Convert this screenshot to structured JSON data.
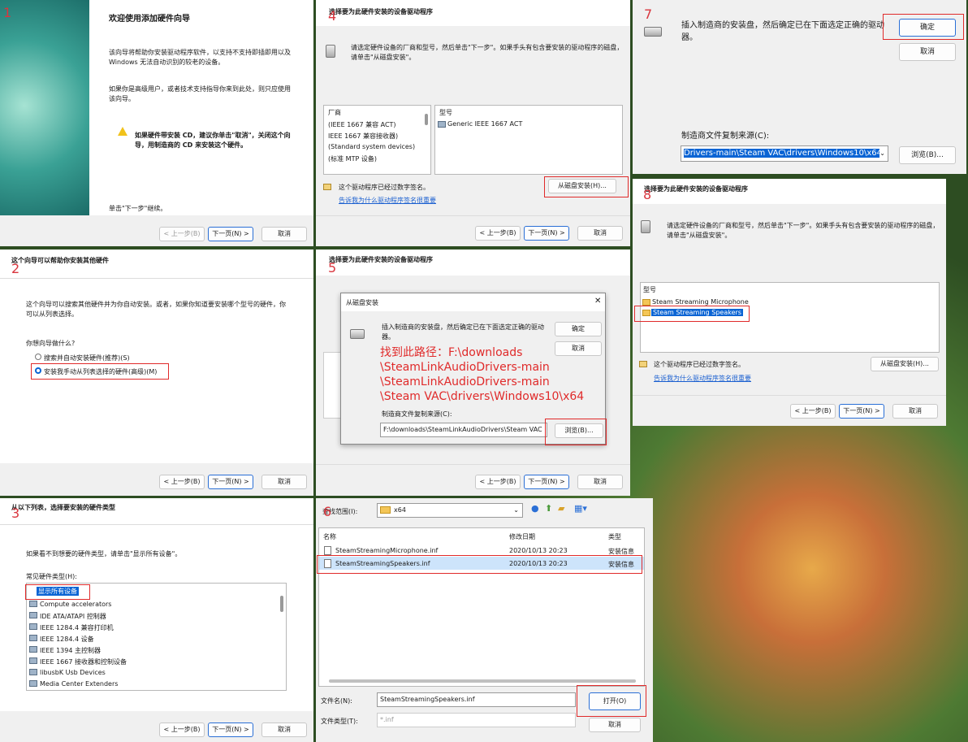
{
  "step_numbers": [
    "1",
    "2",
    "3",
    "4",
    "5",
    "6",
    "7",
    "8"
  ],
  "p1": {
    "title": "欢迎使用添加硬件向导",
    "para1_l1": "该向导将帮助你安装驱动程序软件，以支持不支持即插即用以及",
    "para1_l2": "Windows 无法自动识别的较老的设备。",
    "para2_l1": "如果你是高级用户，或者技术支持指导你来到此处，则只应使用",
    "para2_l2": "该向导。",
    "warn_l1": "如果硬件带安装 CD，建议你单击\"取消\"，关闭这个向",
    "warn_l2": "导，用制造商的 CD 来安装这个硬件。",
    "footer": "单击\"下一步\"继续。",
    "back": "< 上一步(B)",
    "next": "下一页(N) >",
    "cancel": "取消"
  },
  "p2": {
    "title": "这个向导可以帮助你安装其他硬件",
    "desc_l1": "这个向导可以搜索其他硬件并为你自动安装。或者，如果你知道要安装哪个型号的硬件，你",
    "desc_l2": "可以从列表选择。",
    "question": "你想向导做什么?",
    "opt1": "搜索并自动安装硬件(推荐)(S)",
    "opt2": "安装我手动从列表选择的硬件(高级)(M)",
    "back": "< 上一步(B)",
    "next": "下一页(N) >",
    "cancel": "取消"
  },
  "p3": {
    "title": "从以下列表，选择要安装的硬件类型",
    "desc": "如果看不到想要的硬件类型，请单击\"显示所有设备\"。",
    "list_label": "常见硬件类型(H):",
    "items": [
      "显示所有设备",
      "Compute accelerators",
      "IDE ATA/ATAPI 控制器",
      "IEEE 1284.4 兼容打印机",
      "IEEE 1284.4 设备",
      "IEEE 1394 主控制器",
      "IEEE 1667 接收器和控制设备",
      "libusbK Usb Devices",
      "Media Center Extenders"
    ],
    "back": "< 上一步(B)",
    "next": "下一页(N) >",
    "cancel": "取消"
  },
  "p4": {
    "title": "选择要为此硬件安装的设备驱动程序",
    "desc_l1": "请选定硬件设备的厂商和型号，然后单击\"下一步\"。如果手头有包含要安装的驱动程序的磁盘，",
    "desc_l2": "请单击\"从磁盘安装\"。",
    "mfr_header": "厂商",
    "mfr_items": [
      "(IEEE 1667 兼容 ACT)",
      "IEEE 1667 兼容接收器)",
      "(Standard system devices)",
      "(标准 MTP 设备)"
    ],
    "model_header": "型号",
    "model_item": "Generic IEEE 1667 ACT",
    "signed": "这个驱动程序已经过数字签名。",
    "link": "告诉我为什么驱动程序签名很重要",
    "have_disk": "从磁盘安装(H)...",
    "back": "< 上一步(B)",
    "next": "下一页(N) >",
    "cancel": "取消"
  },
  "p5": {
    "title": "选择要为此硬件安装的设备驱动程序",
    "dlg_title": "从磁盘安装",
    "dlg_msg_l1": "插入制造商的安装盘，然后确定已在下面选定正确的驱动",
    "dlg_msg_l2": "器。",
    "ok": "确定",
    "cancel_dlg": "取消",
    "note_l1": "找到此路径：F:\\downloads",
    "note_l2": "\\SteamLinkAudioDrivers-main",
    "note_l3": "\\SteamLinkAudioDrivers-main",
    "note_l4": "\\Steam VAC\\drivers\\Windows10\\x64",
    "copy_label": "制造商文件复制来源(C):",
    "path": "F:\\downloads\\SteamLinkAudioDrivers\\Steam VAC",
    "browse": "浏览(B)...",
    "back": "< 上一步(B)",
    "next": "下一页(N) >",
    "cancel": "取消"
  },
  "p6": {
    "look_in": "查找范围(I):",
    "folder": "x64",
    "col_name": "名称",
    "col_date": "修改日期",
    "col_type": "类型",
    "files": [
      {
        "name": "SteamStreamingMicrophone.inf",
        "date": "2020/10/13 20:23",
        "type": "安装信息"
      },
      {
        "name": "SteamStreamingSpeakers.inf",
        "date": "2020/10/13 20:23",
        "type": "安装信息"
      }
    ],
    "filename_label": "文件名(N):",
    "filename": "SteamStreamingSpeakers.inf",
    "filetype_label": "文件类型(T):",
    "filetype": "*.inf",
    "open": "打开(O)",
    "cancel": "取消"
  },
  "p7": {
    "msg_l1": "插入制造商的安装盘，然后确定已在下面选定正确的驱动",
    "msg_l2": "器。",
    "ok": "确定",
    "cancel": "取消",
    "copy_label": "制造商文件复制来源(C):",
    "path": "Drivers-main\\Steam VAC\\drivers\\Windows10\\x64",
    "browse": "浏览(B)..."
  },
  "p8": {
    "title": "选择要为此硬件安装的设备驱动程序",
    "desc_l1": "请选定硬件设备的厂商和型号，然后单击\"下一步\"。如果手头有包含要安装的驱动程序的磁盘，",
    "desc_l2": "请单击\"从磁盘安装\"。",
    "model_header": "型号",
    "models": [
      "Steam Streaming Microphone",
      "Steam Streaming Speakers"
    ],
    "signed": "这个驱动程序已经过数字签名。",
    "link": "告诉我为什么驱动程序签名很重要",
    "have_disk": "从磁盘安装(H)...",
    "back": "< 上一步(B)",
    "next": "下一页(N) >",
    "cancel": "取消"
  }
}
